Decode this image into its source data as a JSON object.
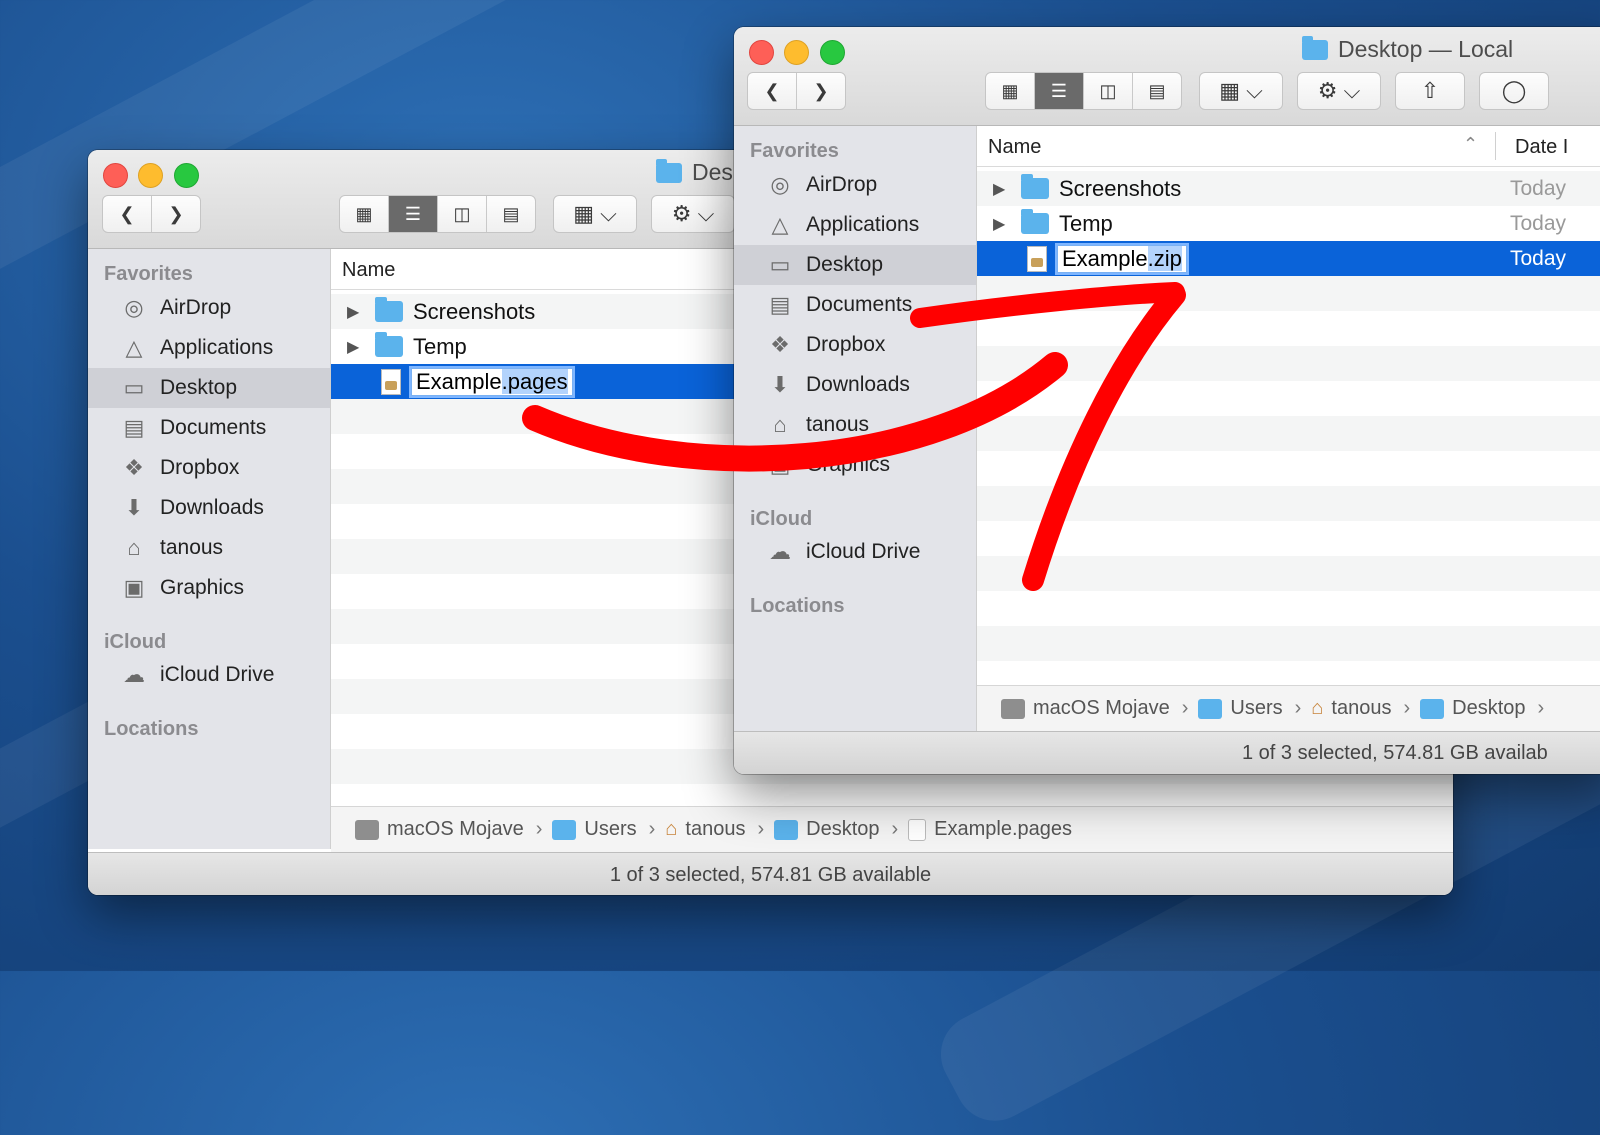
{
  "sidebar": {
    "favorites_heading": "Favorites",
    "icloud_heading": "iCloud",
    "locations_heading": "Locations",
    "items": [
      {
        "label": "AirDrop",
        "icon": "airdrop-icon"
      },
      {
        "label": "Applications",
        "icon": "applications-icon"
      },
      {
        "label": "Desktop",
        "icon": "desktop-icon"
      },
      {
        "label": "Documents",
        "icon": "documents-icon"
      },
      {
        "label": "Dropbox",
        "icon": "dropbox-icon"
      },
      {
        "label": "Downloads",
        "icon": "downloads-icon"
      },
      {
        "label": "tanous",
        "icon": "home-icon"
      },
      {
        "label": "Graphics",
        "icon": "folder-icon"
      }
    ],
    "icloud_drive": "iCloud Drive"
  },
  "back_window": {
    "title": "Desktop",
    "title_visible": "Des",
    "column_name": "Name",
    "rows": [
      {
        "name": "Screenshots"
      },
      {
        "name": "Temp"
      },
      {
        "name_base": "Example",
        "name_ext": ".pages"
      }
    ],
    "path": [
      "macOS Mojave",
      "Users",
      "tanous",
      "Desktop",
      "Example.pages"
    ],
    "status": "1 of 3 selected, 574.81 GB available"
  },
  "front_window": {
    "title": "Desktop — Local",
    "column_name": "Name",
    "column_date": "Date",
    "column_date_visible": "Date I",
    "rows": [
      {
        "name": "Screenshots",
        "date": "Today"
      },
      {
        "name": "Temp",
        "date": "Today"
      },
      {
        "name_base": "Example",
        "name_ext": ".zip",
        "date": "Today"
      }
    ],
    "path": [
      "macOS Mojave",
      "Users",
      "tanous",
      "Desktop"
    ],
    "status": "1 of 3 selected, 574.81 GB availab"
  },
  "colors": {
    "selection": "#0a63d9",
    "folder": "#5bb3ec",
    "arrow": "#ff0000"
  }
}
